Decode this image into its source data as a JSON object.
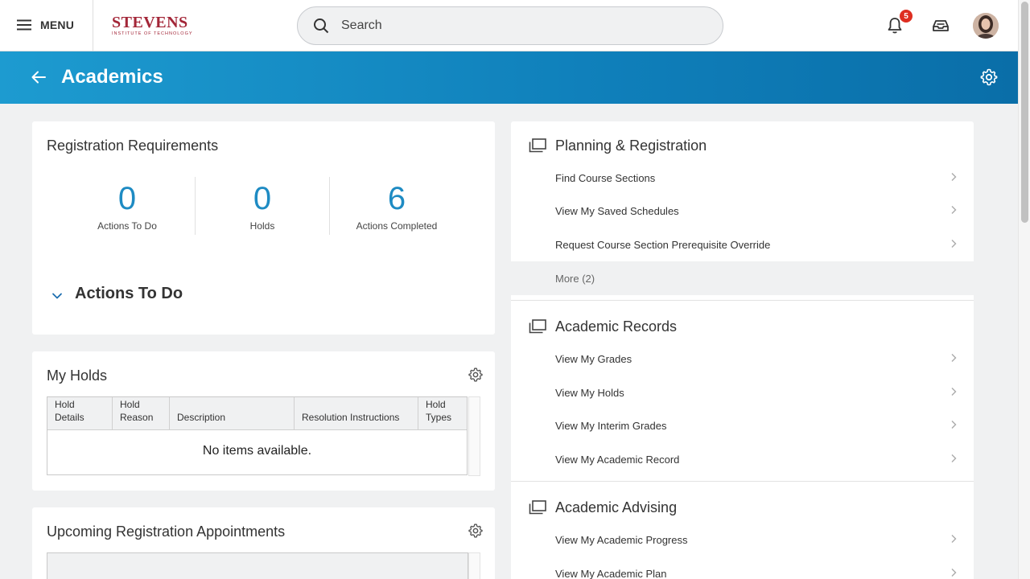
{
  "topbar": {
    "menu_label": "MENU",
    "logo_main": "STEVENS",
    "logo_sub": "INSTITUTE OF TECHNOLOGY",
    "search_placeholder": "Search",
    "notification_count": "5",
    "icons": [
      "hamburger-icon",
      "search-icon",
      "bell-icon",
      "inbox-icon",
      "avatar"
    ]
  },
  "header": {
    "title": "Academics",
    "colors": {
      "gradient_start": "#1d9bd0",
      "gradient_end": "#0a6ea8"
    }
  },
  "registration": {
    "title": "Registration Requirements",
    "stats": [
      {
        "value": "0",
        "label": "Actions To Do"
      },
      {
        "value": "0",
        "label": "Holds"
      },
      {
        "value": "6",
        "label": "Actions Completed"
      }
    ],
    "actions_heading": "Actions To Do",
    "accent": "#1e8bc3"
  },
  "holds": {
    "title": "My Holds",
    "columns": [
      "Hold Details",
      "Hold Reason",
      "Description",
      "Resolution Instructions",
      "Hold Types"
    ],
    "empty_message": "No items available."
  },
  "appointments": {
    "title": "Upcoming Registration Appointments"
  },
  "planning": {
    "title": "Planning & Registration",
    "links": [
      "Find Course Sections",
      "View My Saved Schedules",
      "Request Course Section Prerequisite Override"
    ],
    "more": "More (2)"
  },
  "records": {
    "title": "Academic Records",
    "links": [
      "View My Grades",
      "View My Holds",
      "View My Interim Grades",
      "View My Academic Record"
    ]
  },
  "advising": {
    "title": "Academic Advising",
    "links": [
      "View My Academic Progress",
      "View My Academic Plan"
    ]
  }
}
